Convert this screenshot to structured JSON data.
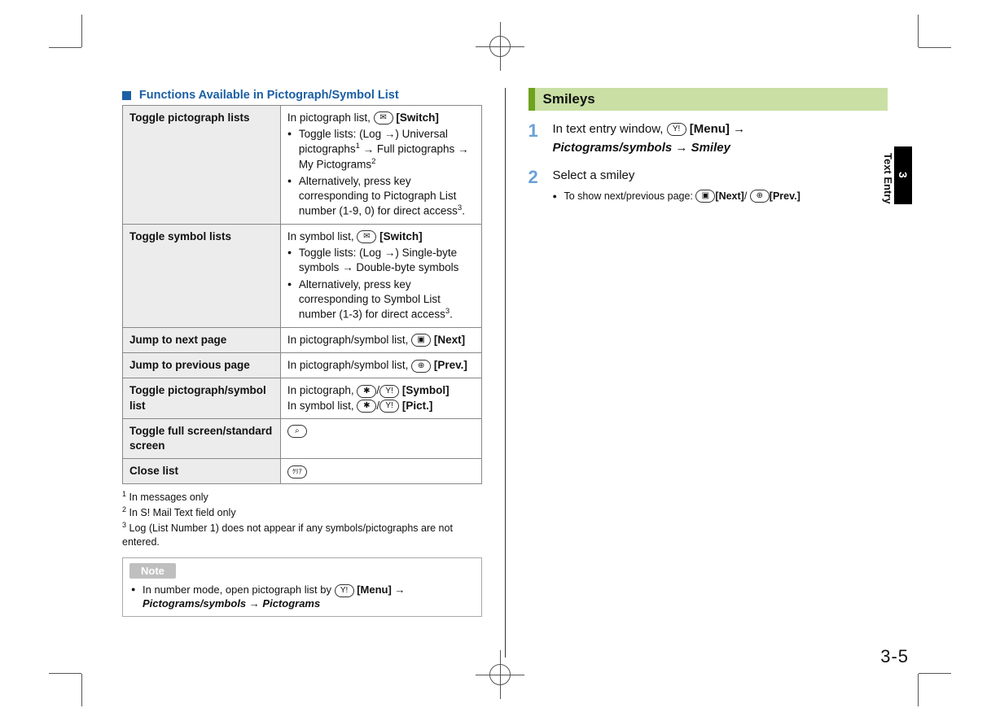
{
  "side": {
    "chapter": "3",
    "label": "Text Entry"
  },
  "pageNumber": "3-5",
  "left": {
    "section_title": "Functions Available in Pictograph/Symbol List",
    "rows": {
      "r1": {
        "label": "Toggle pictograph lists",
        "intro": "In pictograph list, ",
        "switch": "[Switch]",
        "b1a": "Toggle lists: (Log ",
        "b1b": ") Universal pictographs",
        "b1c": " Full pictographs ",
        "b1d": " My Pictograms",
        "b2": "Alternatively, press key corresponding to Pictograph List number (1-9, 0) for direct access"
      },
      "r2": {
        "label": "Toggle symbol lists",
        "intro": "In symbol list, ",
        "switch": "[Switch]",
        "b1a": "Toggle lists: (Log ",
        "b1b": ") Single-byte symbols ",
        "b1c": " Double-byte symbols",
        "b2": "Alternatively, press key corresponding to Symbol List number (1-3) for direct access"
      },
      "r3": {
        "label": "Jump to next page",
        "txt": "In pictograph/symbol list, ",
        "btn": "[Next]"
      },
      "r4": {
        "label": "Jump to previous page",
        "txt": "In pictograph/symbol list, ",
        "btn": "[Prev.]"
      },
      "r5": {
        "label": "Toggle pictograph/symbol list",
        "l1a": "In pictograph, ",
        "l1b": "[Symbol]",
        "l2a": "In symbol list, ",
        "l2b": "[Pict.]"
      },
      "r6": {
        "label": "Toggle full screen/standard screen"
      },
      "r7": {
        "label": "Close list"
      }
    },
    "footnotes": {
      "f1": "In messages only",
      "f2": "In S! Mail Text field only",
      "f3": "Log (List Number 1) does not appear if any symbols/pictographs are not entered."
    },
    "note": {
      "label": "Note",
      "body_a": "In number mode, open pictograph list by ",
      "menu": "[Menu]",
      "path1": "Pictograms/symbols",
      "path2": "Pictograms"
    }
  },
  "right": {
    "header": "Smileys",
    "step1": {
      "a": "In text entry window, ",
      "menu": "[Menu]",
      "path1": "Pictograms/symbols",
      "path2": "Smiley"
    },
    "step2": {
      "title": "Select a smiley",
      "sub": "To show next/previous page: ",
      "next": "[Next]",
      "prev": "[Prev.]"
    }
  }
}
